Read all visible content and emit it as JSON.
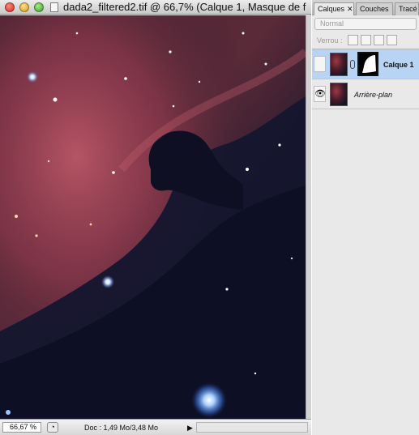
{
  "window": {
    "title": "dada2_filtered2.tif @ 66,7% (Calque 1, Masque de f..."
  },
  "statusbar": {
    "zoom": "66,67 %",
    "doc_size": "Doc : 1,49 Mo/3,48 Mo",
    "arrow": "▶"
  },
  "panel": {
    "tabs": [
      {
        "label": "Calques",
        "close": "✕"
      },
      {
        "label": "Couches"
      },
      {
        "label": "Tracé"
      }
    ],
    "blend_mode": "Normal",
    "lock_label": "Verrou :",
    "layers": [
      {
        "name": "Calque 1",
        "selected": true,
        "has_mask": true
      },
      {
        "name": "Arrière-plan",
        "selected": false,
        "visible": true,
        "eye": "👁"
      }
    ]
  },
  "colors": {
    "nebula_red": "#b24a5c",
    "space_dark": "#14142a",
    "selection_blue": "#b7d4f4"
  },
  "icons": [
    "close-icon",
    "minimize-icon",
    "maximize-icon",
    "document-icon",
    "eye-icon",
    "link-icon",
    "lock-icon",
    "move-icon",
    "brush-icon",
    "transparency-lock-icon"
  ]
}
